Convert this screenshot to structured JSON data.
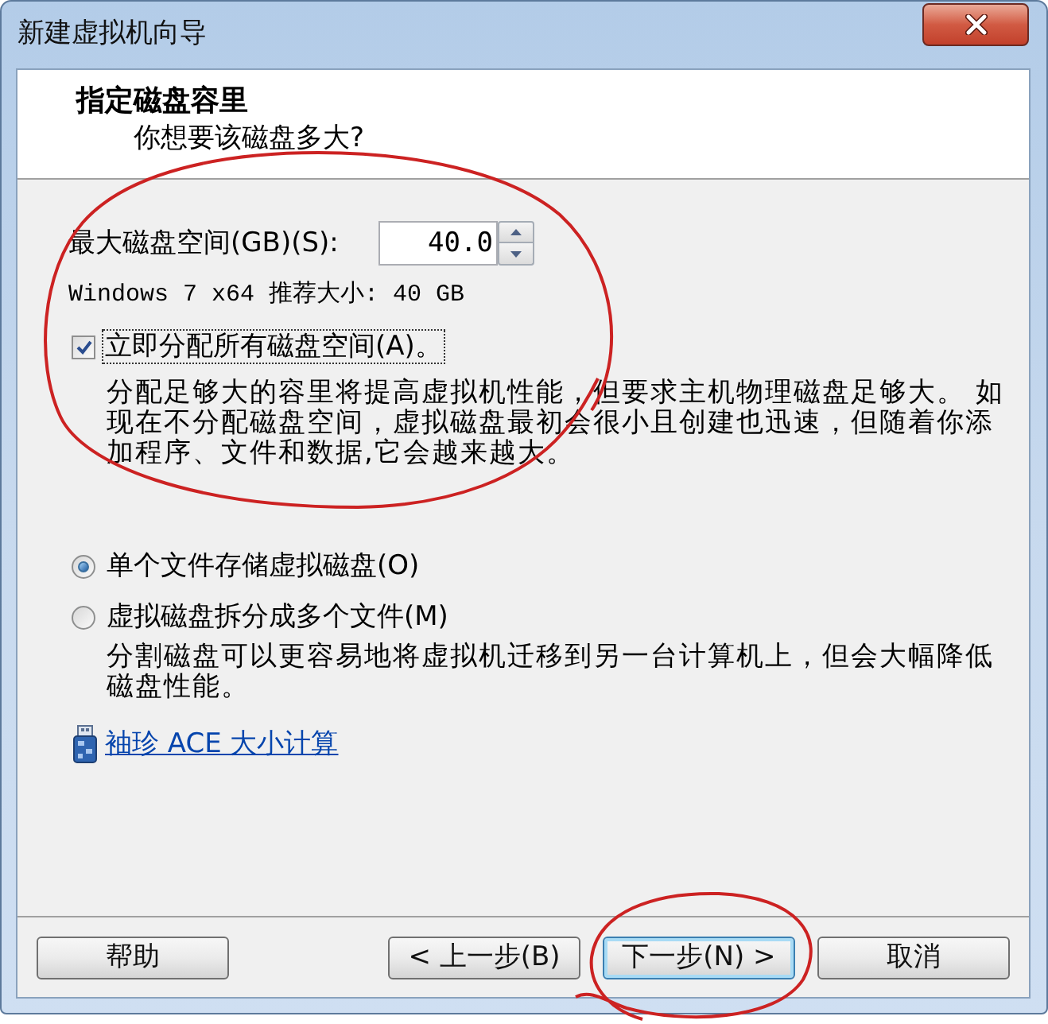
{
  "window": {
    "title": "新建虚拟机向导"
  },
  "header": {
    "title": "指定磁盘容里",
    "subtitle": "你想要该磁盘多大?"
  },
  "disk_size": {
    "label": "最大磁盘空间(GB)(S):",
    "value": "40.0"
  },
  "recommendation": "Windows 7 x64 推荐大小: 40 GB",
  "allocate_all": {
    "label": "立即分配所有磁盘空间(A)。",
    "checked": true,
    "focused": true,
    "description": "分配足够大的容里将提高虚拟机性能，但要求主机物理磁盘足够大。 如现在不分配磁盘空间，虚拟磁盘最初会很小且创建也迅速，但随着你添加程序、文件和数据,它会越来越大。"
  },
  "storage": [
    {
      "label": "单个文件存储虚拟磁盘(O)",
      "selected": true
    },
    {
      "label": "虚拟磁盘拆分成多个文件(M)",
      "selected": false,
      "description": "分割磁盘可以更容易地将虚拟机迁移到另一台计算机上，但会大幅降低磁盘性能。"
    }
  ],
  "link": "袖珍 ACE 大小计算",
  "buttons": [
    {
      "label": "帮助",
      "default": false
    },
    {
      "label": "< 上一步(B)",
      "default": false
    },
    {
      "label": "下一步(N) >",
      "default": true
    },
    {
      "label": "取消",
      "default": false
    }
  ]
}
